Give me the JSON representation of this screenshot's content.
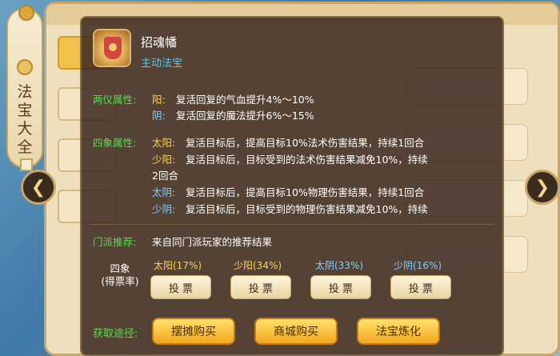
{
  "side_banner": {
    "title": "法宝大全"
  },
  "tooltip": {
    "item_name": "招魂幡",
    "item_type": "主动法宝",
    "liangyi": {
      "label": "两仪属性:",
      "lines": [
        {
          "key": "阳:",
          "text": "复活回复的气血提升4%～10%"
        },
        {
          "key": "阴:",
          "text": "复活回复的魔法提升6%～15%"
        }
      ]
    },
    "sixiang": {
      "label": "四象属性:",
      "lines": [
        {
          "key": "太阳:",
          "text": "复活目标后，提高目标10%法术伤害结果，持续1回合"
        },
        {
          "key": "少阳:",
          "text": "复活目标后，目标受到的法术伤害结果减免10%，持续"
        },
        {
          "key": "",
          "text": "2回合"
        },
        {
          "key": "太阴:",
          "text": "复活目标后，提高目标10%物理伤害结果，持续1回合"
        },
        {
          "key": "少阴:",
          "text": "复活目标后，目标受到的物理伤害结果减免10%，持续"
        }
      ]
    },
    "recommend": {
      "label": "门派推荐:",
      "text": "来自同门派玩家的推荐结果"
    },
    "vote": {
      "title_line1": "四象",
      "title_line2": "(得票率)",
      "options": [
        {
          "label": "太阳(17%)",
          "button": "投 票"
        },
        {
          "label": "少阳(34%)",
          "button": "投 票"
        },
        {
          "label": "太阴(33%)",
          "button": "投 票"
        },
        {
          "label": "少阴(16%)",
          "button": "投 票"
        }
      ]
    },
    "acquire": {
      "label": "获取途径:",
      "buttons": [
        "摆摊购买",
        "商城购买",
        "法宝炼化"
      ]
    }
  }
}
